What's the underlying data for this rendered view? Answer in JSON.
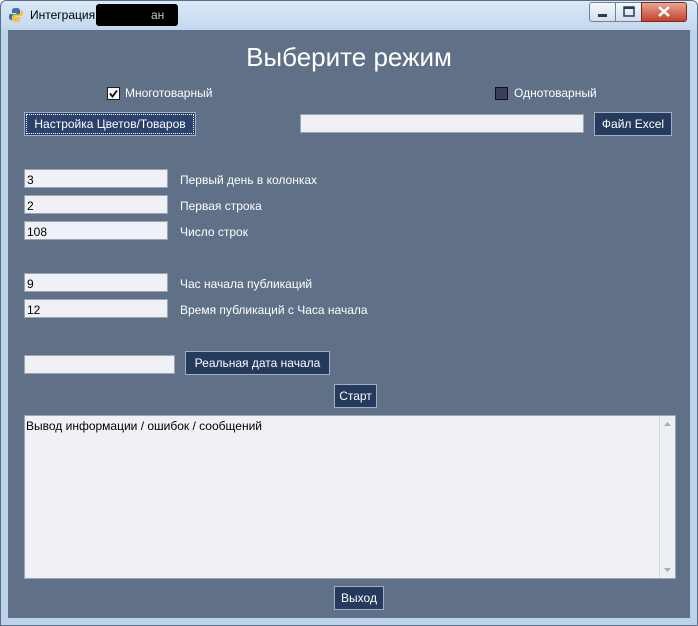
{
  "window": {
    "title": "Интеграция",
    "title_tail": "ан",
    "icons": [
      "python-icon",
      "minimize-icon",
      "maximize-icon",
      "close-icon"
    ]
  },
  "heading": "Выберите режим",
  "mode": {
    "multi_label": "Многотоварный",
    "multi_checked": true,
    "single_label": "Однотоварный",
    "single_checked": false
  },
  "buttons": {
    "settings": "Настройка Цветов/Товаров",
    "excel": "Файл Excel",
    "real_date": "Реальная дата начала",
    "start": "Старт",
    "exit": "Выход"
  },
  "excel_path": "",
  "fields": [
    {
      "value": "3",
      "label": "Первый день в колонках"
    },
    {
      "value": "2",
      "label": "Первая строка"
    },
    {
      "value": "108",
      "label": "Число строк"
    },
    {
      "value": "9",
      "label": "Час начала публикаций"
    },
    {
      "value": "12",
      "label": "Время публикаций с Часа начала"
    }
  ],
  "real_date_value": "",
  "output_text": "Вывод информации / ошибок / сообщений",
  "colors": {
    "background": "#5f7087",
    "button": "#253a5c",
    "text": "#ffffff"
  }
}
